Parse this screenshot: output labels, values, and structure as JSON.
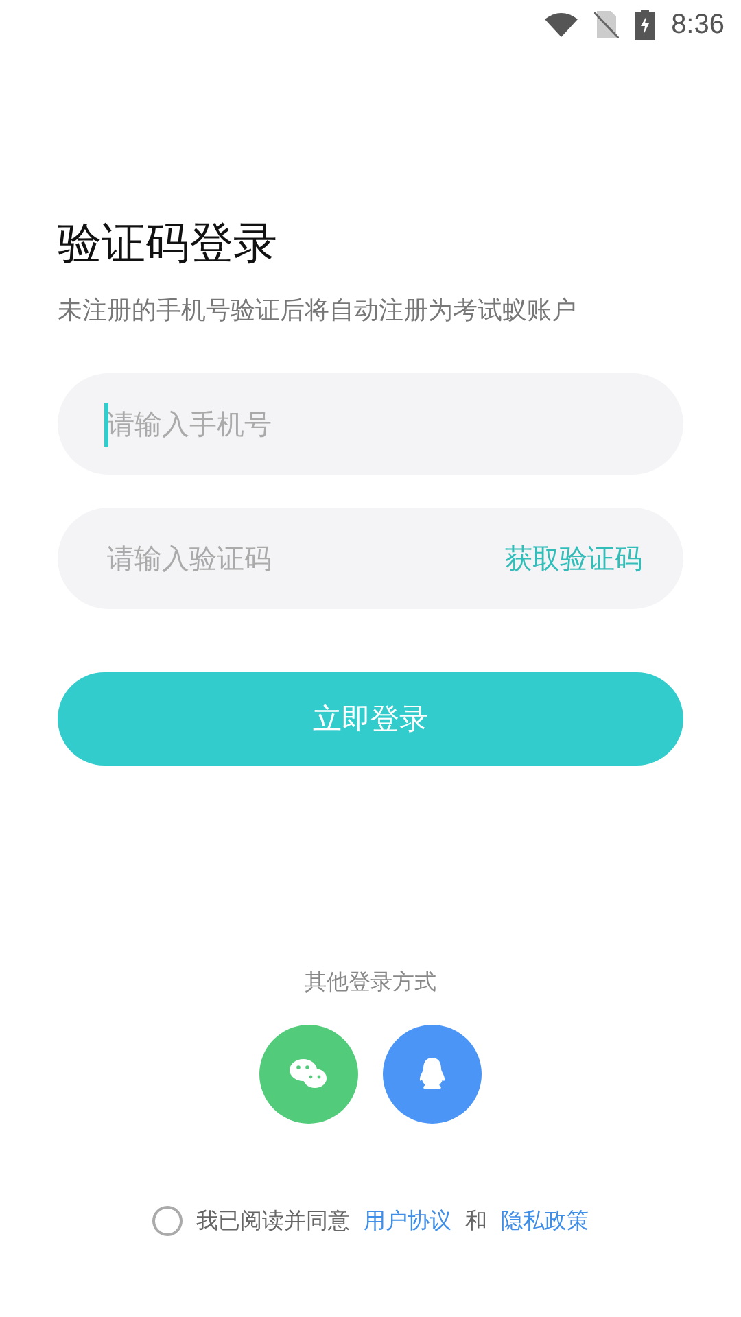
{
  "status_bar": {
    "time": "8:36"
  },
  "title": "验证码登录",
  "subtitle": "未注册的手机号验证后将自动注册为考试蚁账户",
  "phone_field": {
    "placeholder": "请输入手机号",
    "focused": true
  },
  "code_field": {
    "placeholder": "请输入验证码",
    "action": "获取验证码"
  },
  "login_button": "立即登录",
  "other_login": {
    "label": "其他登录方式",
    "methods": [
      {
        "kind": "wechat",
        "color": "#52cc7a"
      },
      {
        "kind": "qq",
        "color": "#4a95f5"
      }
    ]
  },
  "agreement": {
    "checked": false,
    "prefix": "我已阅读并同意",
    "links": [
      "用户协议",
      "隐私政策"
    ],
    "joiner": "和"
  }
}
